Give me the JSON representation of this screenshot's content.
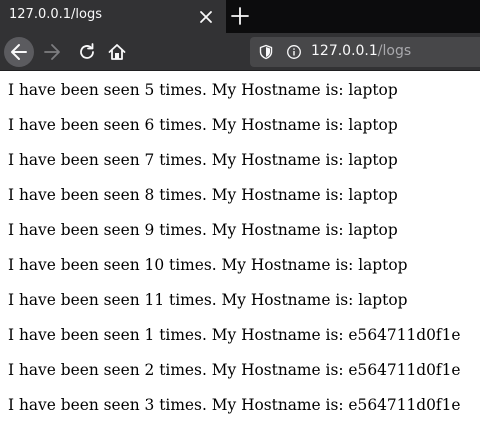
{
  "browser": {
    "tab": {
      "title": "127.0.0.1/logs"
    },
    "address": {
      "host": "127.0.0.1",
      "path": "/logs"
    }
  },
  "logs": [
    "I have been seen 5 times. My Hostname is: laptop",
    "I have been seen 6 times. My Hostname is: laptop",
    "I have been seen 7 times. My Hostname is: laptop",
    "I have been seen 8 times. My Hostname is: laptop",
    "I have been seen 9 times. My Hostname is: laptop",
    "I have been seen 10 times. My Hostname is: laptop",
    "I have been seen 11 times. My Hostname is: laptop",
    "I have been seen 1 times. My Hostname is: e564711d0f1e",
    "I have been seen 2 times. My Hostname is: e564711d0f1e",
    "I have been seen 3 times. My Hostname is: e564711d0f1e"
  ]
}
